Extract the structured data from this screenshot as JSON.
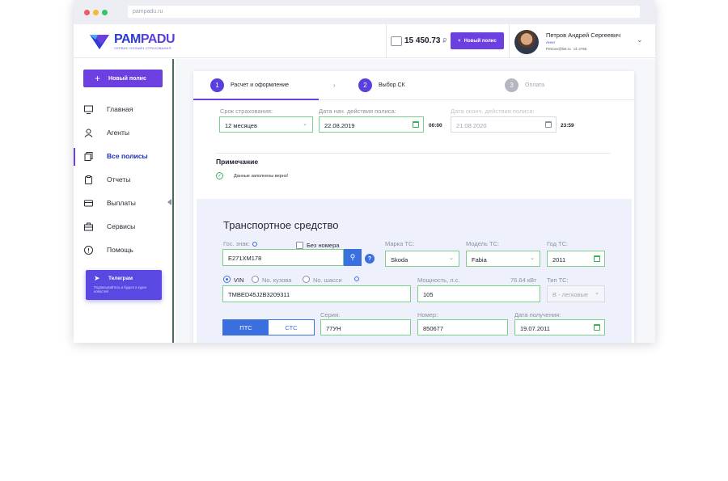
{
  "browser": {
    "url": "pampadu.ru"
  },
  "brand": {
    "name_left": "PAM",
    "name_right": "PADU",
    "tagline": "СЕРВИС ОНЛАЙН СТРАХОВАНИЯ"
  },
  "header": {
    "balance": "15 450.73",
    "currency": "₽",
    "new_policy_label": "Новый полис",
    "user_name": "Петров Андрей Сергеевич",
    "user_role": "Агент",
    "user_email": "Petrovv@list.ru",
    "user_id": "id: 2766"
  },
  "sidebar": {
    "new_policy_label": "Новый полис",
    "items": [
      {
        "label": "Главная",
        "icon": "monitor-icon"
      },
      {
        "label": "Агенты",
        "icon": "user-icon"
      },
      {
        "label": "Все полисы",
        "icon": "documents-icon"
      },
      {
        "label": "Отчеты",
        "icon": "clipboard-icon"
      },
      {
        "label": "Выплаты",
        "icon": "card-icon"
      },
      {
        "label": "Сервисы",
        "icon": "services-icon"
      },
      {
        "label": "Помощь",
        "icon": "help-icon"
      }
    ],
    "active_index": 2,
    "telegram": {
      "title": "Телеграм",
      "text": "Подписывайтесь и будьте в курсе новостей"
    }
  },
  "steps": [
    {
      "num": "1",
      "label": "Расчет и оформление"
    },
    {
      "num": "2",
      "label": "Выбор СК"
    },
    {
      "num": "3",
      "label": "Оплата"
    }
  ],
  "insurance": {
    "term_label": "Срок страхования:",
    "term_value": "12 месяцев",
    "start_label": "Дата нач. действия полиса:",
    "start_value": "22.08.2019",
    "start_time": "00:00",
    "end_label": "Дата оконч. действия полиса:",
    "end_value": "21.08.2020",
    "end_time": "23:59"
  },
  "note": {
    "title": "Примечание",
    "text": "Данные заполнены верно!"
  },
  "vehicle": {
    "title": "Транспортное средство",
    "plate_label": "Гос. знак:",
    "no_plate_label": "Без номера",
    "plate_value": "Е271ХМ178",
    "brand_label": "Марка ТС:",
    "brand_value": "Skoda",
    "model_label": "Модель ТС:",
    "model_value": "Fabia",
    "year_label": "Год ТС:",
    "year_value": "2011",
    "id_options": [
      "VIN",
      "No. кузова",
      "No. шасси"
    ],
    "id_selected": "VIN",
    "vin_value": "TMBED45J2B3209311",
    "power_label": "Мощность, л.с.",
    "power_kw": "76.64 кВт",
    "power_value": "105",
    "type_label": "Тип ТС:",
    "type_value": "В - легковые",
    "doc_options": [
      "ПТС",
      "СТС"
    ],
    "doc_selected": "ПТС",
    "series_label": "Серия:",
    "series_value": "77УН",
    "number_label": "Номер:",
    "number_value": "850677",
    "date_label": "Дата получения:",
    "date_value": "19.07.2011"
  }
}
